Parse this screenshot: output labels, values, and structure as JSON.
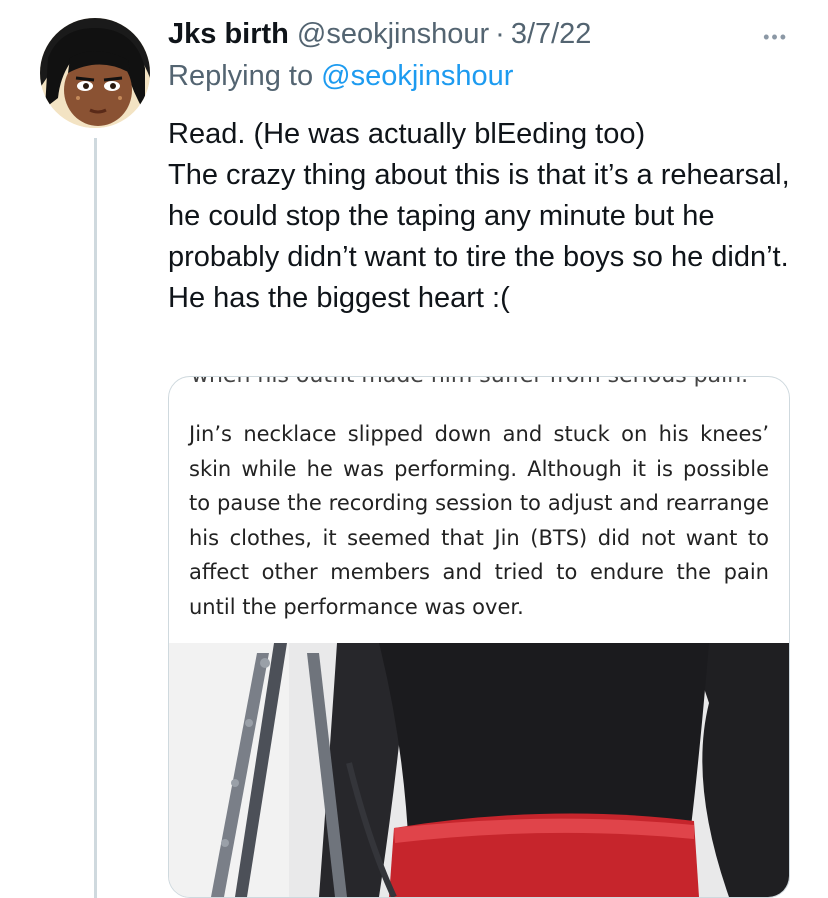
{
  "tweet": {
    "display_name": "Jks birth",
    "handle": "@seokjinshour",
    "separator": "·",
    "date": "3/7/22",
    "more_icon": "more-horizontal-icon",
    "replying_prefix": "Replying to",
    "replying_to": "@seokjinshour",
    "text": "Read. (He was actually blEeding too)\nThe crazy thing about this is that it’s a rehearsal, he could stop the taping any minute but he probably didn’t want to tire the boys so he didn’t. He has the biggest heart :("
  },
  "media": {
    "clipped_line": "when his outfit made him suffer from serious pain.",
    "article_text": "Jin’s necklace slipped down and stuck on his knees’ skin while he was performing. Although it is possible to pause the recording session to adjust and rearrange his clothes, it seemed that Jin (BTS) did not want to affect other members and tried to endure the pain until the performance was over."
  },
  "colors": {
    "text_primary": "#0f1419",
    "text_secondary": "#536471",
    "link": "#1d9bf0",
    "border": "#cfd9de"
  }
}
